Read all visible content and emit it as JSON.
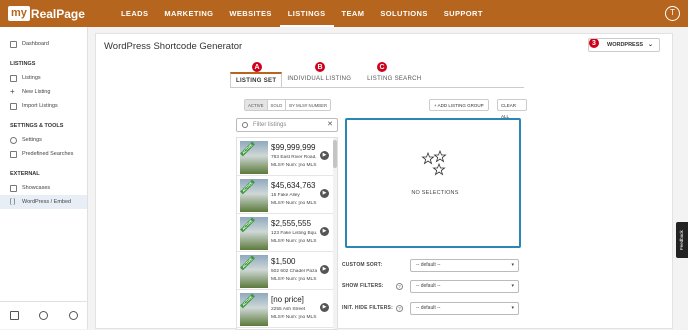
{
  "brand": {
    "my": "my",
    "rest": "RealPage"
  },
  "nav": [
    "LEADS",
    "MARKETING",
    "WEBSITES",
    "LISTINGS",
    "TEAM",
    "SOLUTIONS",
    "SUPPORT"
  ],
  "user_initial": "T",
  "sidebar": {
    "dashboard": "Dashboard",
    "listings_head": "LISTINGS",
    "listings": "Listings",
    "new_listing": "New Listing",
    "import_listings": "Import Listings",
    "settings_head": "SETTINGS & TOOLS",
    "settings": "Settings",
    "predefined": "Predefined Searches",
    "external_head": "EXTERNAL",
    "showcases": "Showcases",
    "wordpress": "WordPress / Embed"
  },
  "page_title": "WordPress Shortcode Generator",
  "wordpress_button": "WORDPRESS",
  "callouts": {
    "a": "A",
    "b": "B",
    "c": "C",
    "three": "3"
  },
  "tabs": [
    "LISTING SET",
    "INDIVIDUAL LISTING",
    "LISTING SEARCH"
  ],
  "filters": [
    "ACTIVE",
    "SOLD",
    "BY MLS# NUMBER"
  ],
  "add_group": "+ ADD LISTING GROUP",
  "clear_all": "CLEAR ALL",
  "search_placeholder": "Filter listings",
  "listings": [
    {
      "price": "$99,999,999",
      "addr": "783 East River Road,",
      "mls": "MLS® Num: [no MLS",
      "ribbon": "ACTIVE"
    },
    {
      "price": "$45,634,763",
      "addr": "15 Fake Alley",
      "mls": "MLS® Num: [no MLS",
      "ribbon": "ACTIVE"
    },
    {
      "price": "$2,555,555",
      "addr": "123 Fake Listing Bqu...",
      "mls": "MLS® Num: [no MLS",
      "ribbon": "ACTIVE"
    },
    {
      "price": "$1,500",
      "addr": "502 602 Chadel Paza",
      "mls": "MLS® Num: [no MLS",
      "ribbon": "ACTIVE"
    },
    {
      "price": "[no price]",
      "addr": "2255 Ash Street",
      "mls": "MLS® Num: [no MLS",
      "ribbon": "ACTIVE"
    }
  ],
  "no_selections": "NO SELECTIONS",
  "options": [
    {
      "label": "CUSTOM SORT:",
      "value": "-- default --",
      "help": false
    },
    {
      "label": "SHOW FILTERS:",
      "value": "-- default --",
      "help": true
    },
    {
      "label": "INIT. HIDE FILTERS:",
      "value": "-- default --",
      "help": true
    }
  ],
  "feedback": "Feedback",
  "colors": {
    "brand": "#b5651d",
    "accent": "#2a86b3",
    "callout": "#d0021b"
  }
}
